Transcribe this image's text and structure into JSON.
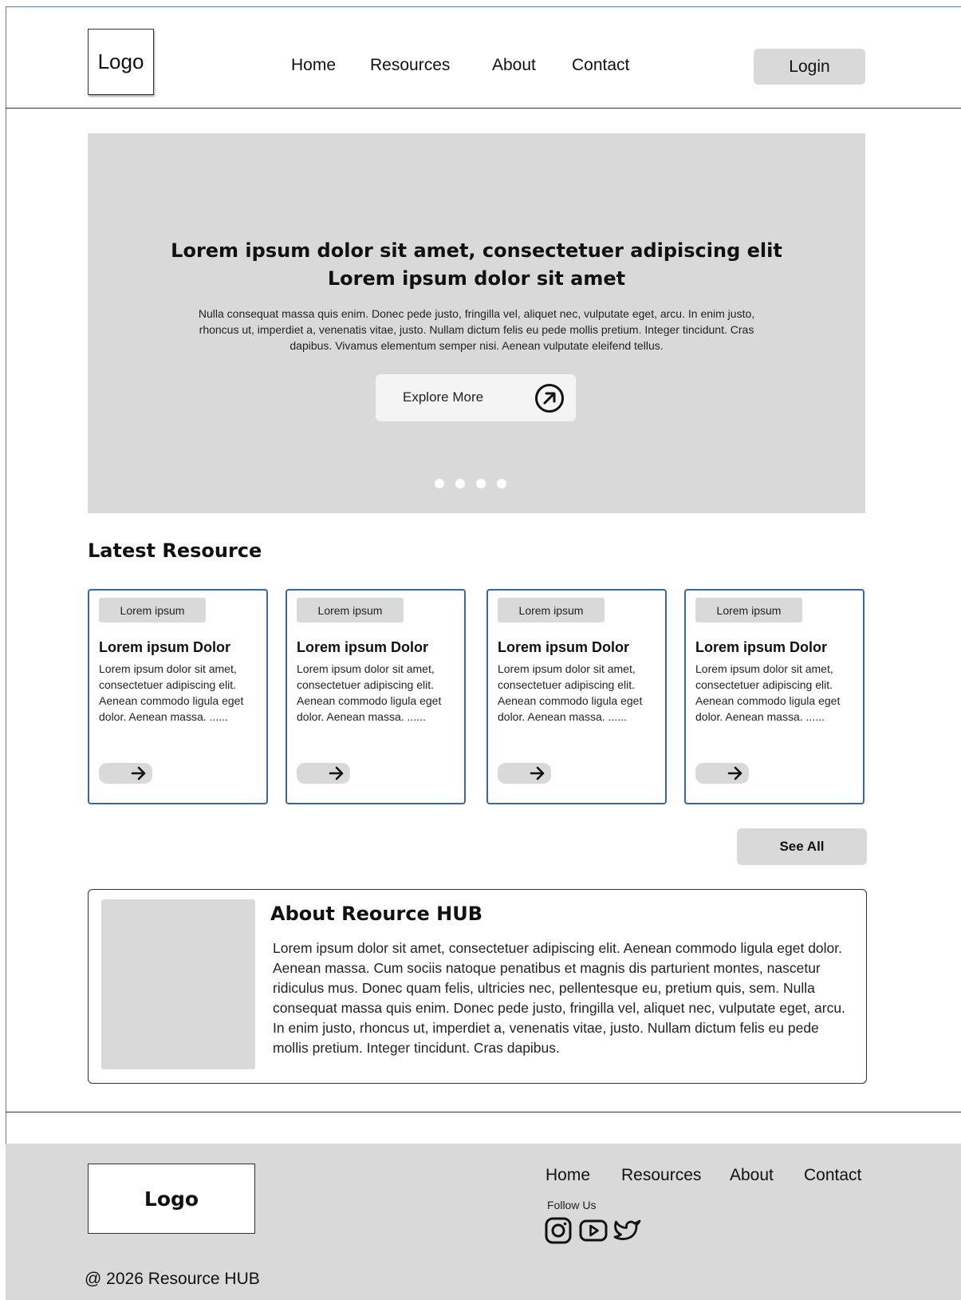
{
  "header": {
    "logo": "Logo",
    "nav": [
      "Home",
      "Resources",
      "About",
      "Contact"
    ],
    "login": "Login"
  },
  "hero": {
    "title_line1": "Lorem ipsum dolor sit amet, consectetuer adipiscing elit",
    "title_line2": "Lorem ipsum dolor sit amet",
    "body": "Nulla consequat massa quis enim. Donec pede justo, fringilla vel, aliquet nec, vulputate eget, arcu. In enim justo, rhoncus ut, imperdiet a, venenatis vitae, justo. Nullam dictum felis eu pede mollis pretium. Integer tincidunt. Cras dapibus. Vivamus elementum semper nisi. Aenean vulputate eleifend tellus.",
    "button": "Explore More",
    "button_icon": "arrow-up-right-circle-icon",
    "slide_count": 4
  },
  "latest": {
    "title": "Latest Resource",
    "cards": [
      {
        "tag": "Lorem ipsum",
        "title": "Lorem ipsum Dolor",
        "text": "Lorem ipsum dolor sit amet, consectetuer adipiscing elit. Aenean commodo ligula eget dolor. Aenean massa. ......"
      },
      {
        "tag": "Lorem ipsum",
        "title": "Lorem ipsum Dolor",
        "text": "Lorem ipsum dolor sit amet, consectetuer adipiscing elit. Aenean commodo ligula eget dolor. Aenean massa. ......"
      },
      {
        "tag": "Lorem ipsum",
        "title": "Lorem ipsum Dolor",
        "text": "Lorem ipsum dolor sit amet, consectetuer adipiscing elit. Aenean commodo ligula eget dolor. Aenean massa. ......"
      },
      {
        "tag": "Lorem ipsum",
        "title": "Lorem ipsum Dolor",
        "text": "Lorem ipsum dolor sit amet, consectetuer adipiscing elit. Aenean commodo ligula eget dolor. Aenean massa. ......"
      }
    ],
    "see_all": "See All"
  },
  "about": {
    "title": "About Reource HUB",
    "text": "Lorem ipsum dolor sit amet, consectetuer adipiscing elit. Aenean commodo ligula eget dolor. Aenean massa. Cum sociis natoque penatibus et magnis dis parturient montes, nascetur ridiculus mus. Donec quam felis, ultricies nec, pellentesque eu, pretium quis, sem. Nulla consequat massa quis enim. Donec pede justo, fringilla vel, aliquet nec, vulputate eget, arcu. In enim justo, rhoncus ut, imperdiet a, venenatis vitae, justo. Nullam dictum felis eu pede mollis pretium. Integer tincidunt. Cras dapibus."
  },
  "footer": {
    "logo": "Logo",
    "nav": [
      "Home",
      "Resources",
      "About",
      "Contact"
    ],
    "follow": "Follow Us",
    "social_icons": [
      "instagram-icon",
      "youtube-icon",
      "twitter-icon"
    ],
    "copyright": "@ 2026 Resource HUB"
  },
  "colors": {
    "card_border": "#3a66a8",
    "placeholder_gray": "#d9d9d9",
    "frame_line": "#4a7fc1"
  }
}
